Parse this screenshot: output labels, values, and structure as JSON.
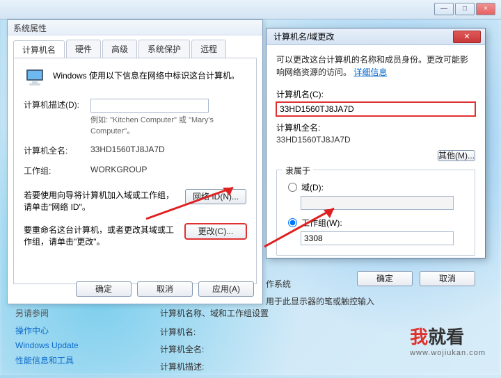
{
  "chrome": {
    "min": "—",
    "max": "□",
    "close": "×"
  },
  "dlg1": {
    "title": "系统属性",
    "tabs": [
      "计算机名",
      "硬件",
      "高级",
      "系统保护",
      "远程"
    ],
    "intro": "Windows 使用以下信息在网络中标识这台计算机。",
    "desc_label": "计算机描述(D):",
    "desc_value": "",
    "desc_hint": "例如: \"Kitchen Computer\" 或 \"Mary's Computer\"。",
    "fullname_label": "计算机全名:",
    "fullname_value": "33HD1560TJ8JA7D",
    "workgroup_label": "工作组:",
    "workgroup_value": "WORKGROUP",
    "netid_text": "若要使用向导将计算机加入域或工作组，请单击\"网络 ID\"。",
    "netid_btn": "网络 ID(N)...",
    "rename_text": "要重命名这台计算机，或者更改其域或工作组，请单击\"更改\"。",
    "change_btn": "更改(C)...",
    "ok": "确定",
    "cancel": "取消",
    "apply": "应用(A)"
  },
  "dlg2": {
    "title": "计算机名/域更改",
    "close": "✕",
    "info": "可以更改这台计算机的名称和成员身份。更改可能影响网络资源的访问。",
    "link": "详细信息",
    "name_label": "计算机名(C):",
    "name_value": "33HD1560TJ8JA7D",
    "fullname_label": "计算机全名:",
    "fullname_value": "33HD1560TJ8JA7D",
    "more_btn": "其他(M)...",
    "member_label": "隶属于",
    "domain_label": "域(D):",
    "workgroup_label": "工作组(W):",
    "workgroup_value": "3308",
    "ok": "确定",
    "cancel": "取消"
  },
  "lower": {
    "l1": "作系统",
    "l2": "用于此显示器的笔或触控输入"
  },
  "side": {
    "header": "另请参阅",
    "a1": "操作中心",
    "a2": "Windows Update",
    "a3": "性能信息和工具"
  },
  "mid": {
    "h": "计算机名称、域和工作组设置",
    "r1": "计算机名:",
    "r2": "计算机全名:",
    "r3": "计算机描述:"
  },
  "wm": {
    "t1": "我",
    "t2": "就看",
    "url": "www.wojiukan.com"
  }
}
